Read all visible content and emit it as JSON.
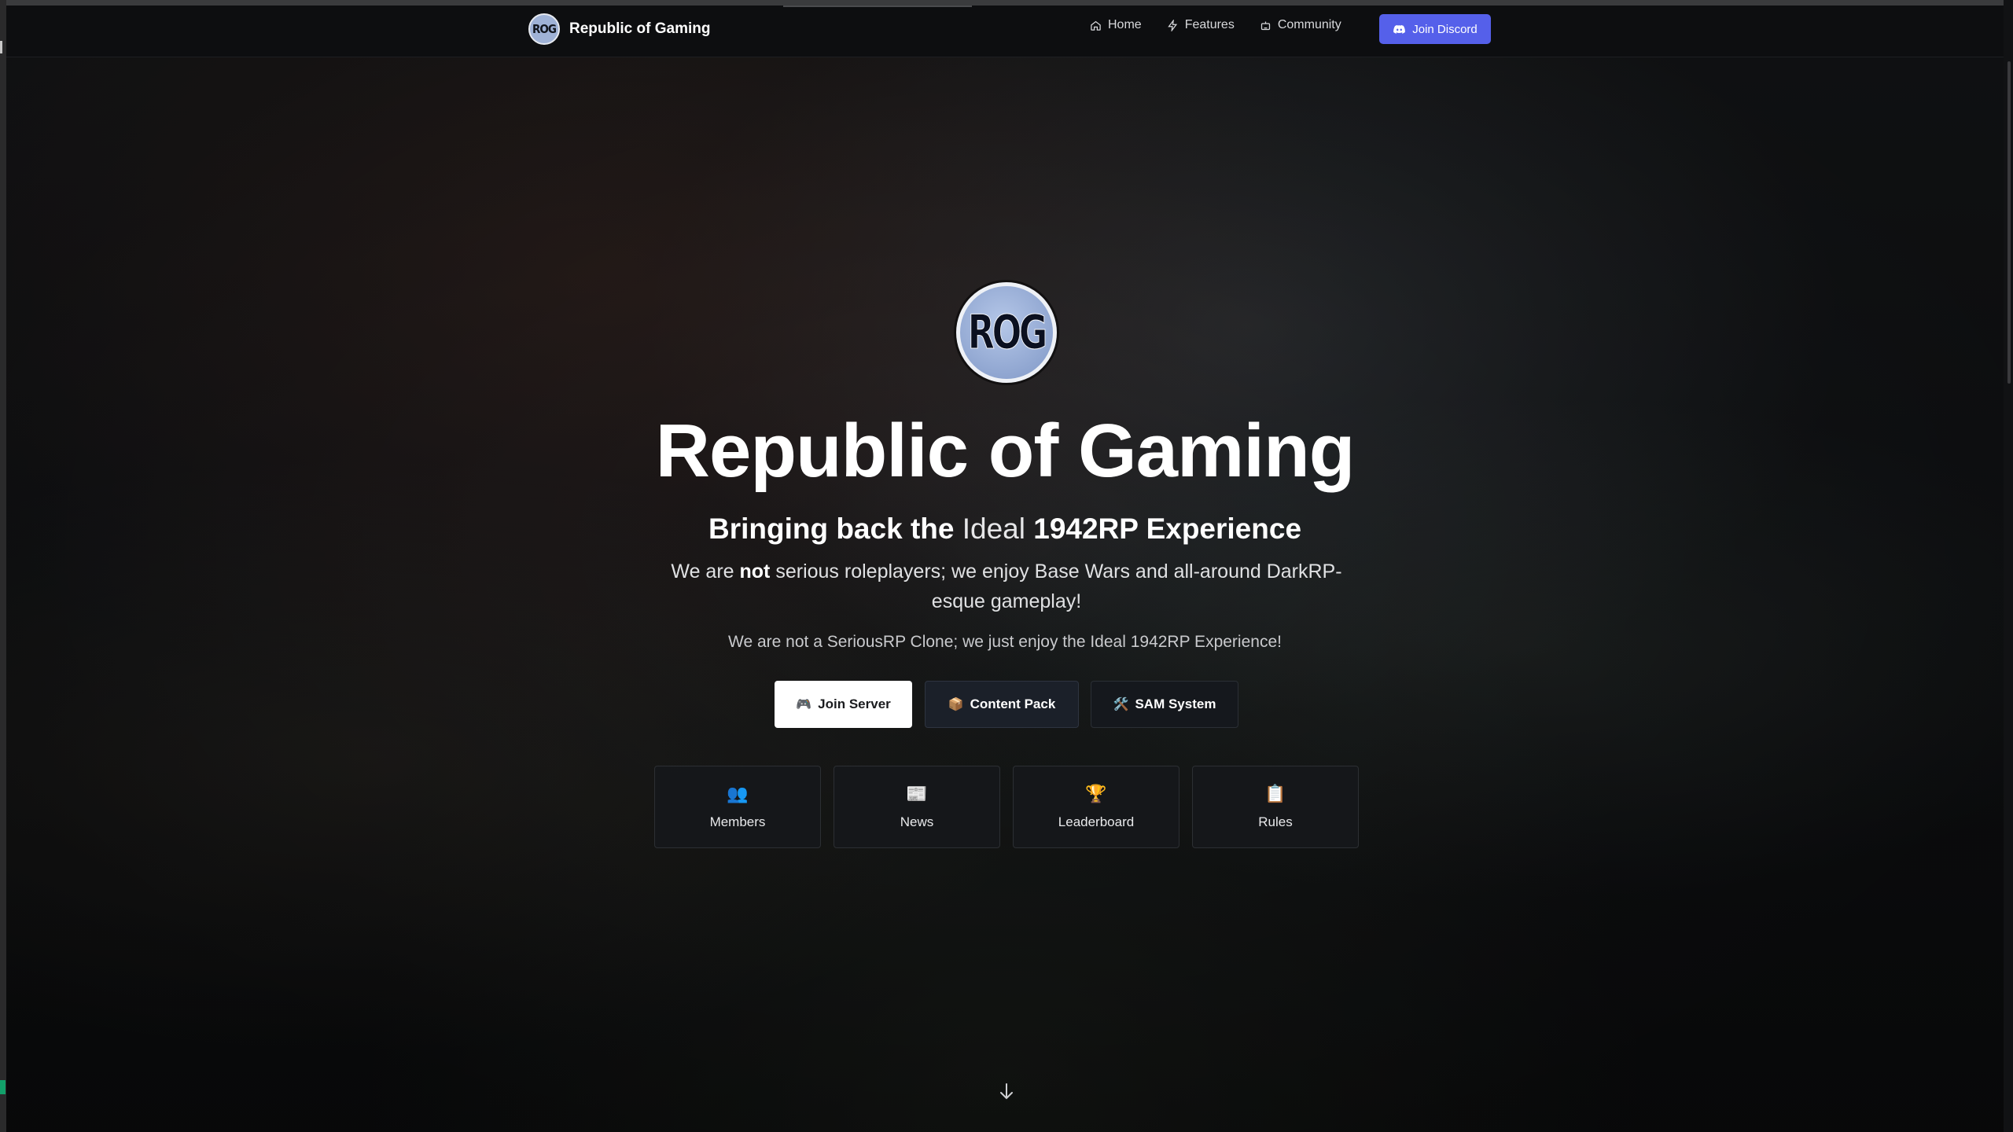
{
  "navbar": {
    "brand_logo_text": "ROG",
    "brand_name": "Republic of Gaming",
    "links": [
      {
        "label": "Home",
        "icon": "home-icon"
      },
      {
        "label": "Features",
        "icon": "lightning-icon"
      },
      {
        "label": "Community",
        "icon": "robot-icon"
      }
    ],
    "cta": {
      "label": "Join Discord",
      "icon": "discord-icon",
      "color": "#5560ea"
    }
  },
  "hero": {
    "logo_text": "ROG",
    "title": "Republic of Gaming",
    "tagline": {
      "part1": "Bringing back the",
      "part2": "Ideal",
      "part3": "1942RP Experience"
    },
    "description": {
      "part1": "We are",
      "bold": "not",
      "part2": "serious roleplayers; we enjoy Base Wars and all-around DarkRP-esque gameplay!"
    },
    "note": "We are not a SeriousRP Clone; we just enjoy the Ideal 1942RP Experience!",
    "buttons": [
      {
        "label": "Join Server",
        "emoji": "🎮"
      },
      {
        "label": "Content Pack",
        "emoji": "📦"
      },
      {
        "label": "SAM System",
        "emoji": "🛠️"
      }
    ],
    "cards": [
      {
        "label": "Members",
        "emoji": "👥"
      },
      {
        "label": "News",
        "emoji": "📰"
      },
      {
        "label": "Leaderboard",
        "emoji": "🏆"
      },
      {
        "label": "Rules",
        "emoji": "📋"
      }
    ],
    "scroll_icon": "arrow-down-icon"
  }
}
